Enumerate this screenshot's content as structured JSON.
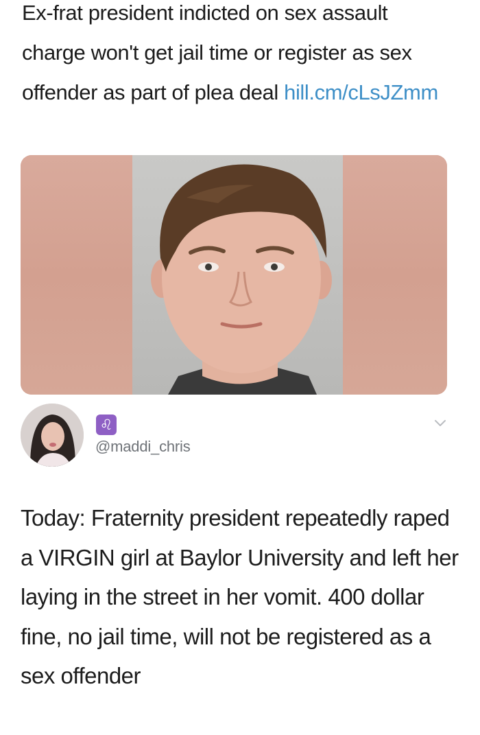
{
  "tweet": {
    "headline": "Ex-frat president indicted on sex assault charge won't get jail time or register as sex offender as part of plea deal",
    "link": "hill.cm/cLsJZmm"
  },
  "quoted_user": {
    "zodiac_glyph": "♌",
    "handle": "@maddi_chris"
  },
  "quoted_tweet": {
    "text": "Today: Fraternity president repeatedly raped a VIRGIN girl at Baylor University and left her laying in the street in her vomit. 400 dollar fine, no jail time, will not be registered as a sex offender"
  },
  "colors": {
    "link": "#3e8fc7",
    "zodiac_badge": "#8e5fc4",
    "handle": "#6f7378"
  },
  "icons": [
    "leo-zodiac-icon",
    "chevron-down-icon"
  ]
}
